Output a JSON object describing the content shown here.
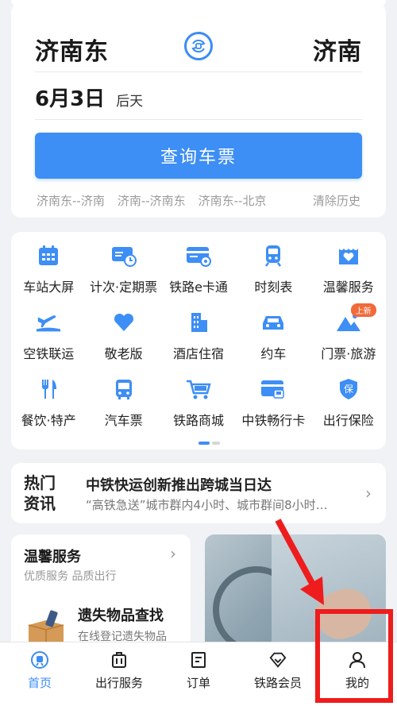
{
  "route": {
    "from_station": "济南东",
    "to_station": "济南",
    "date": "6月3日",
    "weekday": "后天",
    "query_button": "查询车票",
    "history": [
      "济南东--济南",
      "济南--济南东",
      "济南东--北京"
    ],
    "clear_history": "清除历史"
  },
  "services": [
    {
      "label": "车站大屏",
      "icon": "calendar-icon"
    },
    {
      "label": "计次·定期票",
      "icon": "ticket-card-icon"
    },
    {
      "label": "铁路e卡通",
      "icon": "e-card-icon"
    },
    {
      "label": "时刻表",
      "icon": "train-icon"
    },
    {
      "label": "温馨服务",
      "icon": "heart-shop-icon"
    },
    {
      "label": "空铁联运",
      "icon": "plane-train-icon"
    },
    {
      "label": "敬老版",
      "icon": "heart-icon"
    },
    {
      "label": "酒店住宿",
      "icon": "hotel-icon"
    },
    {
      "label": "约车",
      "icon": "car-icon"
    },
    {
      "label": "门票·旅游",
      "icon": "mountain-icon",
      "badge": "上新"
    },
    {
      "label": "餐饮·特产",
      "icon": "fork-knife-icon"
    },
    {
      "label": "汽车票",
      "icon": "bus-icon"
    },
    {
      "label": "铁路商城",
      "icon": "cart-icon"
    },
    {
      "label": "中铁畅行卡",
      "icon": "membership-card-icon"
    },
    {
      "label": "出行保险",
      "icon": "shield-insurance-icon"
    }
  ],
  "news": {
    "logo": [
      "热门",
      "资讯"
    ],
    "title": "中铁快运创新推出跨城当日达",
    "subtitle": "“高铁急送”城市群内4小时、城市群间8小时…"
  },
  "warm_service": {
    "title": "温馨服务",
    "subtitle": "优质服务 品质出行",
    "item_title": "遗失物品查找",
    "item_subtitle": "在线登记遗失物品"
  },
  "tabbar": [
    {
      "label": "首页",
      "icon": "home-train-icon",
      "active": true
    },
    {
      "label": "出行服务",
      "icon": "luggage-icon",
      "active": false
    },
    {
      "label": "订单",
      "icon": "order-list-icon",
      "active": false
    },
    {
      "label": "铁路会员",
      "icon": "diamond-icon",
      "active": false
    },
    {
      "label": "我的",
      "icon": "person-icon",
      "active": false
    }
  ],
  "colors": {
    "accent": "#3d8ef5",
    "annotation": "#ee1c1c",
    "badge": "#f06a3a"
  }
}
